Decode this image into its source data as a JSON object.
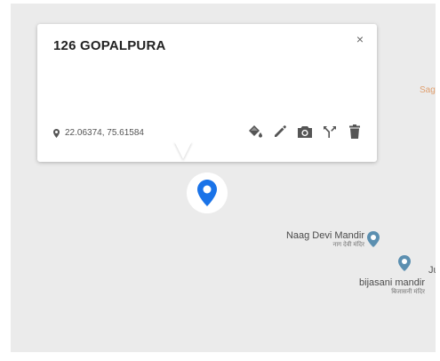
{
  "popup": {
    "title": "126 GOPALPURA",
    "coordinates": "22.06374, 75.61584",
    "close_symbol": "×",
    "actions": [
      {
        "name": "style-icon"
      },
      {
        "name": "edit-icon"
      },
      {
        "name": "camera-icon"
      },
      {
        "name": "directions-icon"
      },
      {
        "name": "delete-icon"
      }
    ]
  },
  "map": {
    "background": "#ebebeb",
    "marker_color": "#1a73e8",
    "places": [
      {
        "name": "Naag Devi Mandir",
        "local_name": "नाग देवी मंदिर"
      },
      {
        "name": "bijasani mandir",
        "local_name": "बिजासनी मंदिर"
      }
    ],
    "edge_labels": [
      {
        "text": "Sag",
        "color": "#e0a070"
      },
      {
        "text": "Ju",
        "color": "#555555"
      }
    ],
    "poi_color": "#5b8fb0"
  }
}
